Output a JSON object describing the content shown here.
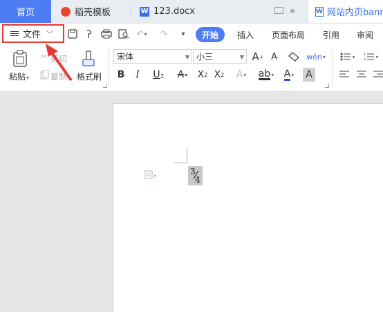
{
  "tabs": {
    "home": "首页",
    "templates": "稻壳模板",
    "doc": "123.docx",
    "web": "网站内页banne"
  },
  "file_menu": {
    "label": "文件"
  },
  "menu_tabs": [
    "开始",
    "插入",
    "页面布局",
    "引用",
    "审阅"
  ],
  "clipboard": {
    "paste": "粘贴",
    "cut": "剪切",
    "copy": "复制",
    "format_painter": "格式刷"
  },
  "font": {
    "name": "宋体",
    "size": "小三"
  },
  "document": {
    "fraction_numerator": "3",
    "fraction_denominator": "4"
  },
  "colors": {
    "accent": "#4d7cf3",
    "highlight_box": "#e53935"
  }
}
